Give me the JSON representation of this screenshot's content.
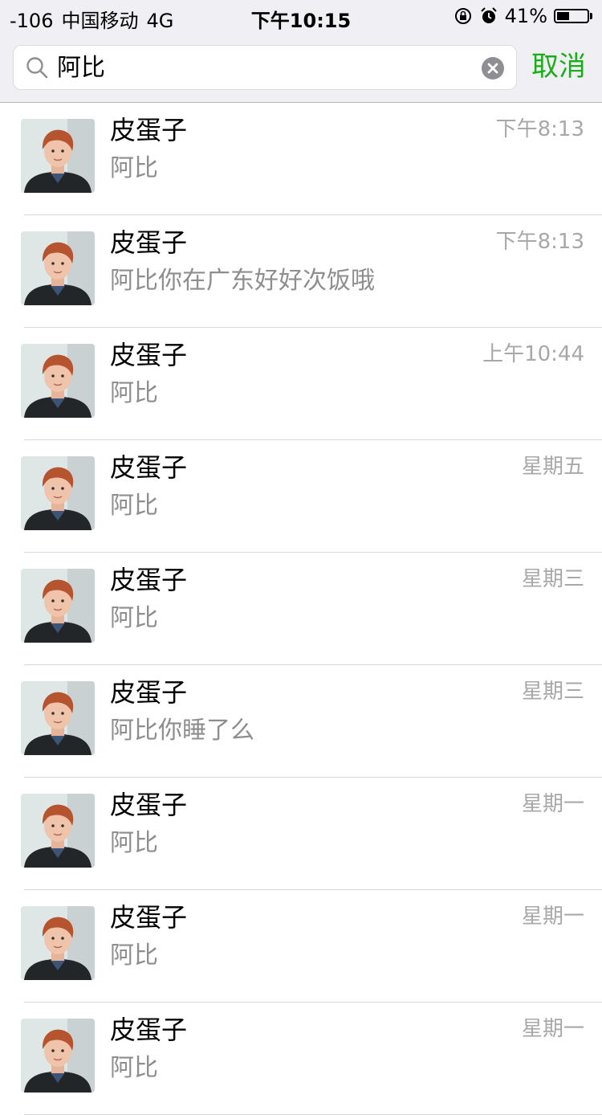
{
  "status_bar": {
    "signal": "-106",
    "carrier": "中国移动",
    "network": "4G",
    "time": "下午10:15",
    "battery": "41%",
    "battery_level": 0.41
  },
  "search": {
    "value": "阿比",
    "cancel_label": "取消"
  },
  "results": [
    {
      "name": "皮蛋子",
      "time": "下午8:13",
      "message": "阿比"
    },
    {
      "name": "皮蛋子",
      "time": "下午8:13",
      "message": "阿比你在广东好好次饭哦"
    },
    {
      "name": "皮蛋子",
      "time": "上午10:44",
      "message": "阿比"
    },
    {
      "name": "皮蛋子",
      "time": "星期五",
      "message": "阿比"
    },
    {
      "name": "皮蛋子",
      "time": "星期三",
      "message": "阿比"
    },
    {
      "name": "皮蛋子",
      "time": "星期三",
      "message": "阿比你睡了么"
    },
    {
      "name": "皮蛋子",
      "time": "星期一",
      "message": "阿比"
    },
    {
      "name": "皮蛋子",
      "time": "星期一",
      "message": "阿比"
    },
    {
      "name": "皮蛋子",
      "time": "星期一",
      "message": "阿比"
    }
  ],
  "colors": {
    "accent": "#1aad19",
    "header_bg": "#efeff4",
    "secondary_text": "#8e8e8e",
    "time_text": "#a8a8a8"
  }
}
